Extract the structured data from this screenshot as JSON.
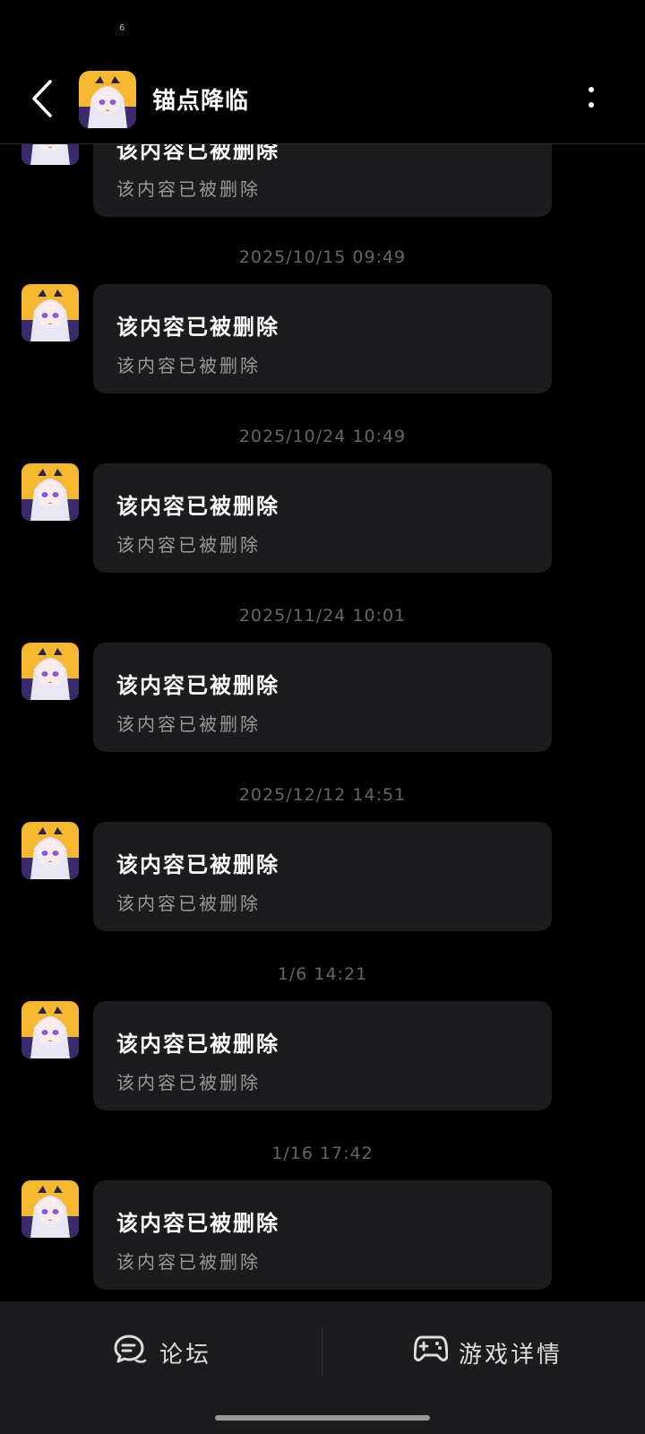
{
  "status_bar": {
    "text": "6"
  },
  "header": {
    "title": "锚点降临",
    "avatar_icon": "game-avatar-icon",
    "back_icon": "chevron-left-icon",
    "more_icon": "more-vertical-icon"
  },
  "messages": {
    "partial": {
      "title": "该内容已被删除",
      "body": "该内容已被删除"
    },
    "items": [
      {
        "time": "2025/10/15  09:49",
        "title": "该内容已被删除",
        "body": "该内容已被删除"
      },
      {
        "time": "2025/10/24  10:49",
        "title": "该内容已被删除",
        "body": "该内容已被删除"
      },
      {
        "time": "2025/11/24  10:01",
        "title": "该内容已被删除",
        "body": "该内容已被删除"
      },
      {
        "time": "2025/12/12  14:51",
        "title": "该内容已被删除",
        "body": "该内容已被删除"
      },
      {
        "time": "1/6  14:21",
        "title": "该内容已被删除",
        "body": "该内容已被删除"
      },
      {
        "time": "1/16  17:42",
        "title": "该内容已被删除",
        "body": "该内容已被删除"
      }
    ]
  },
  "bottom_bar": {
    "forum": {
      "label": "论坛",
      "icon": "chat-bubble-icon"
    },
    "game_details": {
      "label": "游戏详情",
      "icon": "gamepad-icon"
    }
  },
  "colors": {
    "background": "#000000",
    "card": "#1c1c1e",
    "timestamp": "#666666",
    "avatar_accent": "#f5b82e"
  }
}
